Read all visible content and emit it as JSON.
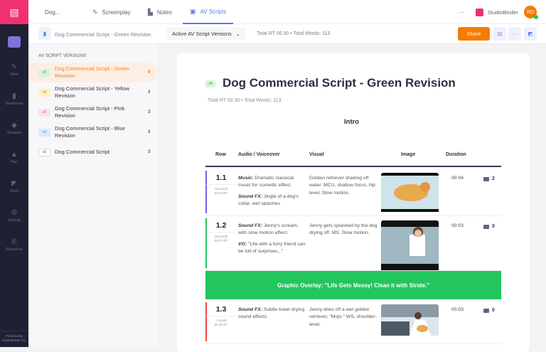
{
  "nav": {
    "items": [
      "Write",
      "Breakdown",
      "Visualize",
      "Plan",
      "Shoot",
      "Settings",
      "Resources"
    ],
    "powered": "Powered By StudioBinder Inc."
  },
  "top": {
    "project": "Dog...",
    "tabs": [
      "Screenplay",
      "Notes",
      "AV Scripts"
    ],
    "more": "···",
    "workspace": "StudioBinder",
    "avatar": "RD"
  },
  "bar": {
    "doc": "Dog Commercial Script - Green Revision",
    "versions_dropdown": "Active AV Script Versions",
    "totals": "Total RT 00:30 • Total Words: 113",
    "share": "Share",
    "more": "···"
  },
  "sidebar": {
    "heading": "AV SCRIPT VERSIONS",
    "versions": [
      {
        "badge": "v5",
        "name": "Dog Commercial Script - Green Revision",
        "count": "9",
        "bg": "#d6f5dd",
        "fg": "#27a745"
      },
      {
        "badge": "v4",
        "name": "Dog Commercial Script - Yellow Revision",
        "count": "3",
        "bg": "#fdf1c4",
        "fg": "#b08b00"
      },
      {
        "badge": "v3",
        "name": "Dog Commercial Script - Pink Revision",
        "count": "3",
        "bg": "#fde1ec",
        "fg": "#e04a85"
      },
      {
        "badge": "v2",
        "name": "Dog Commercial Script - Blue Revision",
        "count": "3",
        "bg": "#d7ecfd",
        "fg": "#2f86d6"
      },
      {
        "badge": "v1",
        "name": "Dog Commercial Script",
        "count": "3",
        "bg": "#ffffff",
        "fg": "#333333"
      }
    ]
  },
  "doc": {
    "badge": "v5",
    "title": "Dog Commercial Script - Green Revision",
    "totals": "Total RT 00:30 • Total Words: 113",
    "section": "Intro",
    "headers": [
      "Row",
      "Audio / Voiceover",
      "Visual",
      "Image",
      "Duration"
    ],
    "rows": [
      {
        "no": "1.1",
        "words": "16 words",
        "rt": "00:04 RT",
        "a1l": "Music:",
        "a1": " Dramatic classical music for comedic effect.",
        "a2l": "Sound FX:",
        "a2": " Jingle of a dog's collar, wet splashes",
        "visual": "Golden retriever shaking off water. MCU, shallow focus, hip level. Slow motion.",
        "duration": "00:04",
        "comments": "2",
        "color": "#7b5cf0"
      },
      {
        "no": "1.2",
        "words": "19 words",
        "rt": "00:07 RT",
        "a1l": "Sound FX:",
        "a1": " Jenny's scream, with slow motion effect.",
        "a2l": "VO:",
        "a2": " \"Life with a furry friend can be full of surprises...\"",
        "visual": "Jenny gets splashed by the dog drying off. MS. Slow motion.",
        "duration": "00:03",
        "comments": "0",
        "color": "#22c55e"
      },
      {
        "no": "1.3",
        "words": "7 words",
        "rt": "00:10 RT",
        "a1l": "Sound FX:",
        "a1": " Subtle towel drying sound effects.",
        "visual": "Jenny dries off a wet golden retriever, \"Mojo.\" WS, shoulder-level.",
        "duration": "00:03",
        "comments": "0",
        "color": "#ef4444"
      }
    ],
    "overlay": "Graphic Overlay: \"Life Gets Messy! Clean it with Stride.\""
  },
  "colors": {
    "accent": "#f57c00",
    "overlay": "#22c55e",
    "nav": "#1f2033",
    "logo": "#f0306f"
  }
}
